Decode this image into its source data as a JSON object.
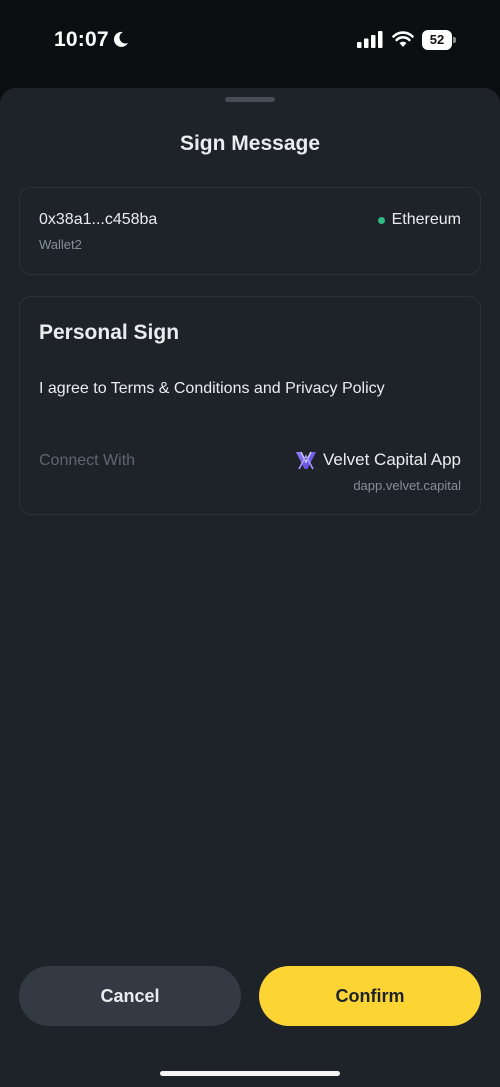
{
  "status_bar": {
    "time": "10:07",
    "battery": "52"
  },
  "sheet": {
    "title": "Sign Message"
  },
  "wallet": {
    "address": "0x38a1...c458ba",
    "name": "Wallet2",
    "network": "Ethereum",
    "network_dot_color": "#2ebd85"
  },
  "sign": {
    "title": "Personal Sign",
    "message": "I agree to Terms & Conditions and Privacy Policy",
    "connect_label": "Connect With",
    "dapp_name": "Velvet Capital App",
    "dapp_url": "dapp.velvet.capital",
    "dapp_icon": "velvet-logo-icon"
  },
  "actions": {
    "cancel_label": "Cancel",
    "confirm_label": "Confirm",
    "accent_color": "#fcd535"
  },
  "icons": {
    "moon": "moon-icon",
    "signal": "cellular-signal-icon",
    "wifi": "wifi-icon",
    "battery": "battery-icon"
  }
}
